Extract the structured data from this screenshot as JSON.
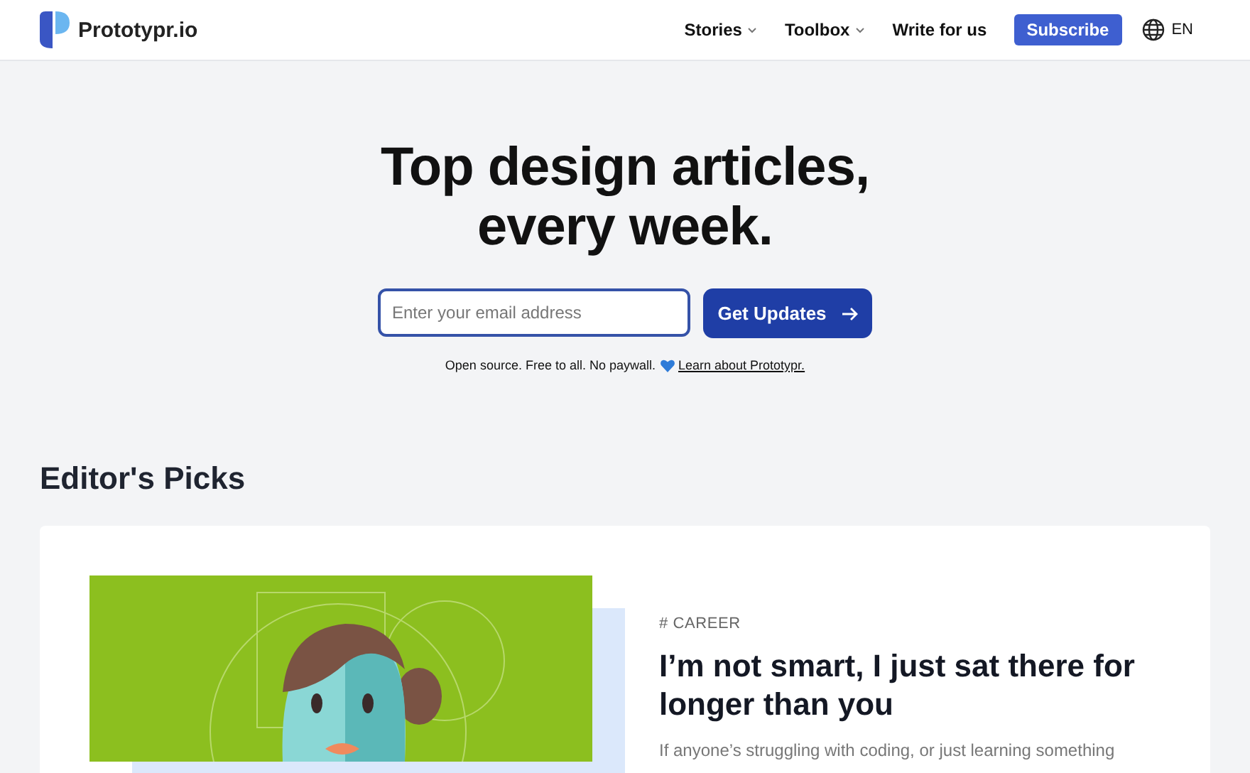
{
  "header": {
    "logo_text": "Prototypr.io",
    "nav": [
      {
        "label": "Stories",
        "kind": "dropdown"
      },
      {
        "label": "Toolbox",
        "kind": "dropdown"
      },
      {
        "label": "Write for us",
        "kind": "link"
      },
      {
        "label": "Subscribe",
        "kind": "button"
      }
    ],
    "language": "EN"
  },
  "hero": {
    "title_lines": [
      "Top design articles,",
      "every week."
    ],
    "email": {
      "placeholder": "Enter your email address"
    },
    "submit": "Get Updates",
    "note": "Open source. Free to all. No paywall.",
    "note_link": "Learn about Prototypr."
  },
  "editors_picks": {
    "heading": "Editor's Picks",
    "article": {
      "tag": "# CAREER",
      "title": "I’m not smart, I just sat there for longer than you",
      "excerpt": "If anyone’s struggling with coding, or just learning something"
    }
  }
}
